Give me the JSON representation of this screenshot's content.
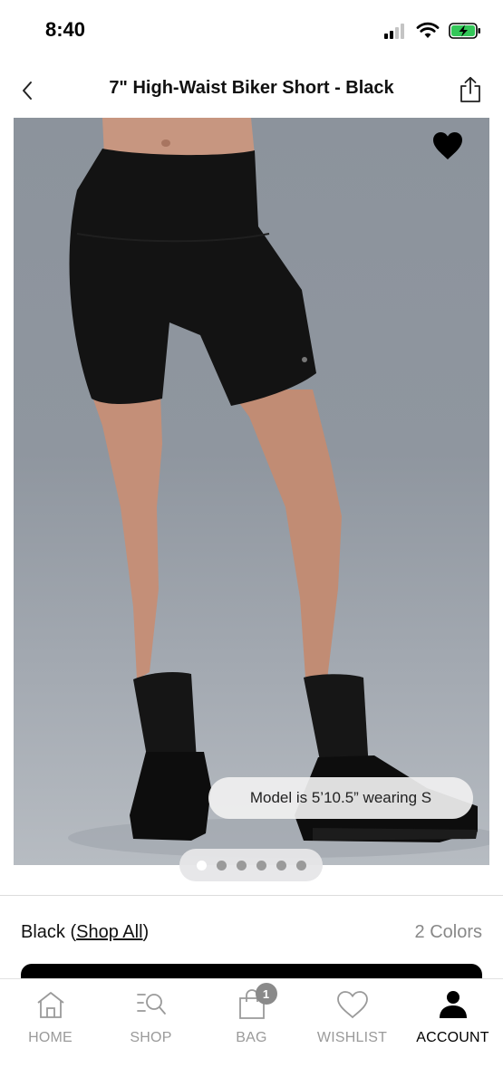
{
  "status_bar": {
    "time": "8:40"
  },
  "header": {
    "title": "7\" High-Waist Biker Short - Black"
  },
  "product": {
    "model_info": "Model is 5’10.5” wearing S",
    "image_count": 6,
    "active_image_index": 0,
    "wishlisted": true
  },
  "color": {
    "selected_name": "Black",
    "open_paren": " (",
    "shop_all_label": "Shop All",
    "close_paren": ")",
    "count_label": "2 Colors"
  },
  "tabs": [
    {
      "label": "HOME",
      "icon": "home-icon"
    },
    {
      "label": "SHOP",
      "icon": "shop-search-icon"
    },
    {
      "label": "BAG",
      "icon": "bag-icon",
      "badge": "1"
    },
    {
      "label": "WISHLIST",
      "icon": "heart-outline-icon"
    },
    {
      "label": "ACCOUNT",
      "icon": "account-icon",
      "active": true
    }
  ],
  "colors": {
    "accent": "#000000",
    "inactive": "#9a9a9a",
    "image_background": "#8f969f"
  }
}
